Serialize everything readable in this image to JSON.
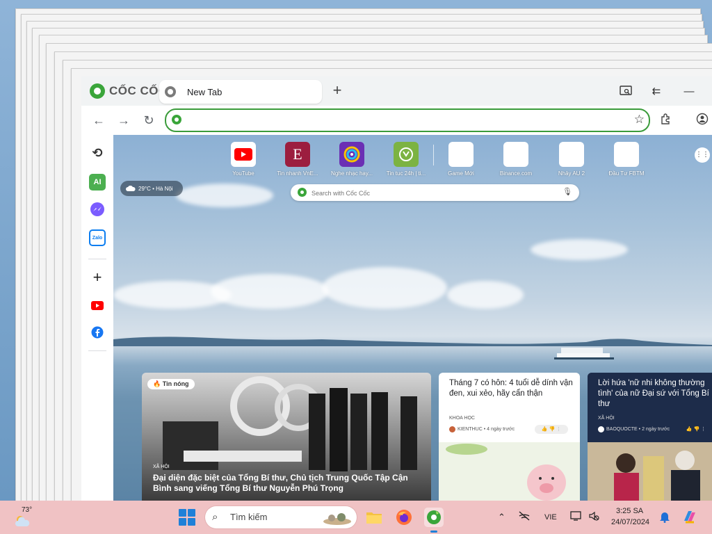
{
  "browser": {
    "brand": "CỐC CỐC",
    "tab_title": "New Tab",
    "omnibox_value": ""
  },
  "shortcuts": [
    {
      "label": "YouTube",
      "icon": "youtube-icon",
      "color": "#ff0000"
    },
    {
      "label": "Tin nhanh VnE...",
      "icon": "vnexpress-icon",
      "color": "#9c1e3f"
    },
    {
      "label": "Nghe nhạc hay...",
      "icon": "music-icon",
      "color": "#6b2fb4"
    },
    {
      "label": "Tin tuc 24h | ti...",
      "icon": "news24h-icon",
      "color": "#7cb342"
    },
    {
      "label": "Game Mới",
      "icon": "game-icon",
      "color": "#ffffff"
    },
    {
      "label": "Binance.com",
      "icon": "binance-icon",
      "color": "#ffffff"
    },
    {
      "label": "Nhảy AU 2",
      "icon": "au2-icon",
      "color": "#ffffff"
    },
    {
      "label": "Đầu Tư FBTM",
      "icon": "fbtm-icon",
      "color": "#ffffff"
    }
  ],
  "weather_chip": "29°C • Hà Nội",
  "search": {
    "placeholder": "Search with Cốc Cốc"
  },
  "sidebar": {
    "ai_label": "AI",
    "zalo_label": "Zalo"
  },
  "news": {
    "hot_badge": "Tin nóng",
    "main": {
      "category": "XÃ HỘI",
      "headline": "Đại diện đặc biệt của Tổng Bí thư, Chủ tịch Trung Quốc Tập Cận Bình sang viếng Tổng Bí thư Nguyễn Phú Trọng"
    },
    "card2": {
      "title": "Tháng 7 có hôn: 4 tuổi dễ dính vận đen, xui xẻo, hãy cẩn thận",
      "category": "KHOA HỌC",
      "source": "KIENTHUC • 4 ngày trước"
    },
    "card3": {
      "title": "Lời hứa 'nữ nhi không thường tình' của nữ Đại sứ với Tổng Bí thư",
      "category": "XÃ HỘI",
      "source": "BAOQUOCTE • 2 ngày trước"
    }
  },
  "taskbar": {
    "temperature": "73°",
    "search_label": "Tìm kiếm",
    "language": "VIE",
    "time": "3:25 SA",
    "date": "24/07/2024"
  },
  "colors": {
    "accent": "#3aa53a",
    "taskbar": "#f0c2c4"
  }
}
